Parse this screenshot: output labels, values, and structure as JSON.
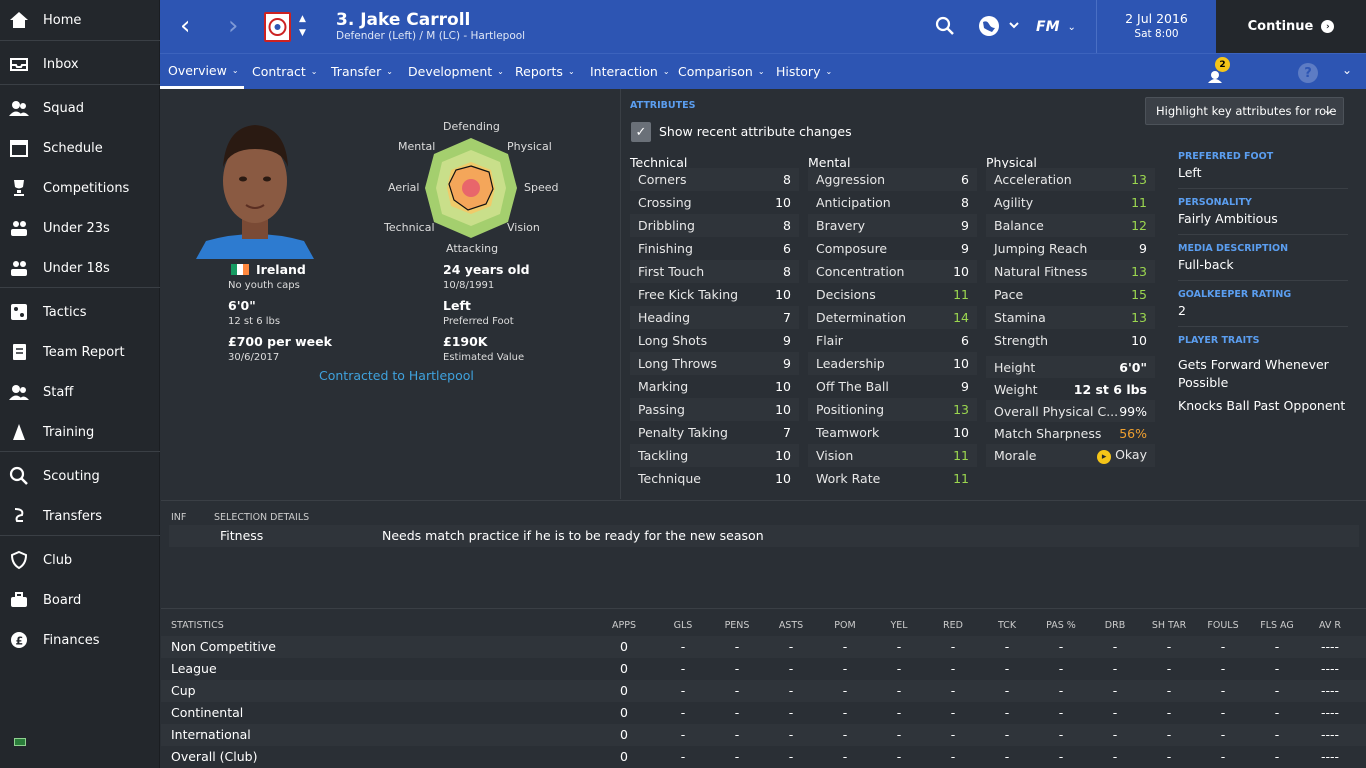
{
  "sidebar": {
    "items": [
      {
        "label": "Home",
        "icon": "home-icon"
      },
      {
        "label": "Inbox",
        "icon": "inbox-icon"
      },
      {
        "label": "Squad",
        "icon": "squad-icon"
      },
      {
        "label": "Schedule",
        "icon": "calendar-icon"
      },
      {
        "label": "Competitions",
        "icon": "trophy-icon"
      },
      {
        "label": "Under 23s",
        "icon": "u23-icon"
      },
      {
        "label": "Under 18s",
        "icon": "u18-icon"
      },
      {
        "label": "Tactics",
        "icon": "tactics-icon"
      },
      {
        "label": "Team Report",
        "icon": "report-icon"
      },
      {
        "label": "Staff",
        "icon": "staff-icon"
      },
      {
        "label": "Training",
        "icon": "training-icon"
      },
      {
        "label": "Scouting",
        "icon": "search-icon"
      },
      {
        "label": "Transfers",
        "icon": "transfers-icon"
      },
      {
        "label": "Club",
        "icon": "club-icon"
      },
      {
        "label": "Board",
        "icon": "board-icon"
      },
      {
        "label": "Finances",
        "icon": "finances-icon"
      }
    ]
  },
  "header": {
    "player_name": "3. Jake Carroll",
    "player_sub": "Defender (Left) / M (LC) - Hartlepool",
    "date": "2 Jul 2016",
    "time": "Sat 8:00",
    "continue": "Continue",
    "fm_logo": "FM",
    "notification_count": "2"
  },
  "nav": {
    "tabs": [
      "Overview",
      "Contract",
      "Transfer",
      "Development",
      "Reports",
      "Interaction",
      "Comparison",
      "History"
    ],
    "active": "Overview"
  },
  "profile": {
    "nationality": "Ireland",
    "youth_caps": "No youth caps",
    "height": "6'0\"",
    "weight": "12 st 6 lbs",
    "wage": "£700 per week",
    "contract_end": "30/6/2017",
    "age": "24 years old",
    "dob": "10/8/1991",
    "foot": "Left",
    "foot_label": "Preferred Foot",
    "value": "£190K",
    "value_label": "Estimated Value",
    "contracted": "Contracted to Hartlepool",
    "radar_labels": {
      "top": "Defending",
      "tl": "Mental",
      "tr": "Physical",
      "l": "Aerial",
      "r": "Speed",
      "bl": "Technical",
      "br": "Vision",
      "b": "Attacking"
    }
  },
  "attributes": {
    "title": "ATTRIBUTES",
    "checkbox_label": "Show recent attribute changes",
    "highlight_dropdown": "Highlight key attributes for role",
    "technical_title": "Technical",
    "mental_title": "Mental",
    "physical_title": "Physical",
    "technical": [
      [
        "Corners",
        "8"
      ],
      [
        "Crossing",
        "10"
      ],
      [
        "Dribbling",
        "8"
      ],
      [
        "Finishing",
        "6"
      ],
      [
        "First Touch",
        "8"
      ],
      [
        "Free Kick Taking",
        "10"
      ],
      [
        "Heading",
        "7"
      ],
      [
        "Long Shots",
        "9"
      ],
      [
        "Long Throws",
        "9"
      ],
      [
        "Marking",
        "10"
      ],
      [
        "Passing",
        "10"
      ],
      [
        "Penalty Taking",
        "7"
      ],
      [
        "Tackling",
        "10"
      ],
      [
        "Technique",
        "10"
      ]
    ],
    "mental": [
      [
        "Aggression",
        "6"
      ],
      [
        "Anticipation",
        "8"
      ],
      [
        "Bravery",
        "9"
      ],
      [
        "Composure",
        "9"
      ],
      [
        "Concentration",
        "10"
      ],
      [
        "Decisions",
        "11"
      ],
      [
        "Determination",
        "14"
      ],
      [
        "Flair",
        "6"
      ],
      [
        "Leadership",
        "10"
      ],
      [
        "Off The Ball",
        "9"
      ],
      [
        "Positioning",
        "13"
      ],
      [
        "Teamwork",
        "10"
      ],
      [
        "Vision",
        "11"
      ],
      [
        "Work Rate",
        "11"
      ]
    ],
    "physical": [
      [
        "Acceleration",
        "13"
      ],
      [
        "Agility",
        "11"
      ],
      [
        "Balance",
        "12"
      ],
      [
        "Jumping Reach",
        "9"
      ],
      [
        "Natural Fitness",
        "13"
      ],
      [
        "Pace",
        "15"
      ],
      [
        "Stamina",
        "13"
      ],
      [
        "Strength",
        "10"
      ]
    ],
    "extra": [
      [
        "Height",
        "6'0\""
      ],
      [
        "Weight",
        "12 st 6 lbs"
      ],
      [
        "Overall Physical C...",
        "99%"
      ],
      [
        "Match Sharpness",
        "56%"
      ],
      [
        "Morale",
        "Okay"
      ]
    ]
  },
  "side_info": {
    "preferred_foot_h": "PREFERRED FOOT",
    "preferred_foot": "Left",
    "personality_h": "PERSONALITY",
    "personality": "Fairly Ambitious",
    "media_h": "MEDIA DESCRIPTION",
    "media": "Full-back",
    "gk_h": "GOALKEEPER RATING",
    "gk": "2",
    "traits_h": "PLAYER TRAITS",
    "trait1": "Gets Forward Whenever Possible",
    "trait2": "Knocks Ball Past Opponent"
  },
  "selection": {
    "col1": "INF",
    "col2": "SELECTION DETAILS",
    "label": "Fitness",
    "detail": "Needs match practice if he is to be ready for the new season"
  },
  "statistics": {
    "title": "STATISTICS",
    "columns": [
      "APPS",
      "GLS",
      "PENS",
      "ASTS",
      "POM",
      "YEL",
      "RED",
      "TCK",
      "PAS %",
      "DRB",
      "SH TAR",
      "FOULS",
      "FLS AG",
      "AV R"
    ],
    "rows": [
      {
        "name": "Non Competitive",
        "values": [
          "0",
          "-",
          "-",
          "-",
          "-",
          "-",
          "-",
          "-",
          "-",
          "-",
          "-",
          "-",
          "-",
          "----"
        ]
      },
      {
        "name": "League",
        "values": [
          "0",
          "-",
          "-",
          "-",
          "-",
          "-",
          "-",
          "-",
          "-",
          "-",
          "-",
          "-",
          "-",
          "----"
        ]
      },
      {
        "name": "Cup",
        "values": [
          "0",
          "-",
          "-",
          "-",
          "-",
          "-",
          "-",
          "-",
          "-",
          "-",
          "-",
          "-",
          "-",
          "----"
        ]
      },
      {
        "name": "Continental",
        "values": [
          "0",
          "-",
          "-",
          "-",
          "-",
          "-",
          "-",
          "-",
          "-",
          "-",
          "-",
          "-",
          "-",
          "----"
        ]
      },
      {
        "name": "International",
        "values": [
          "0",
          "-",
          "-",
          "-",
          "-",
          "-",
          "-",
          "-",
          "-",
          "-",
          "-",
          "-",
          "-",
          "----"
        ]
      },
      {
        "name": "Overall (Club)",
        "values": [
          "0",
          "-",
          "-",
          "-",
          "-",
          "-",
          "-",
          "-",
          "-",
          "-",
          "-",
          "-",
          "-",
          "----"
        ]
      }
    ]
  },
  "colors": {
    "accent": "#2d55b3",
    "green": "#9bd64f",
    "orange": "#f0a030",
    "link": "#3fa2dd"
  }
}
